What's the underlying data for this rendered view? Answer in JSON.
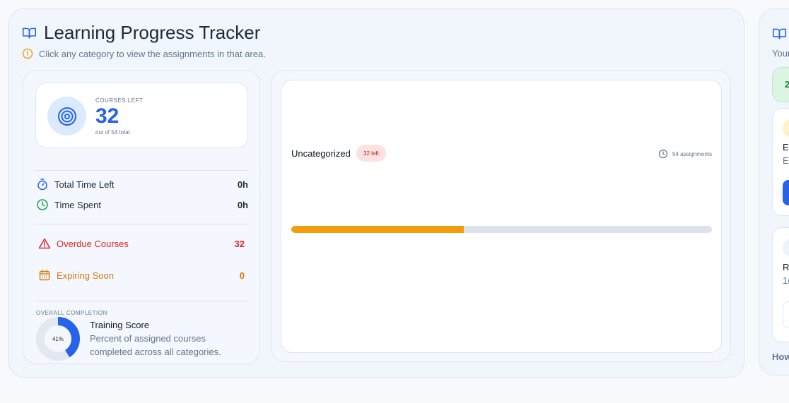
{
  "header": {
    "title": "Learning Progress Tracker",
    "hint": "Click any category to view the assignments in that area."
  },
  "summary": {
    "courses_left_label": "COURSES LEFT",
    "courses_left_value": "32",
    "courses_left_sub": "out of 54 total",
    "total_time_left_label": "Total Time Left",
    "total_time_left_value": "0h",
    "time_spent_label": "Time Spent",
    "time_spent_value": "0h",
    "overdue_label": "Overdue Courses",
    "overdue_value": "32",
    "expiring_label": "Expiring Soon",
    "expiring_value": "0",
    "overall_label": "OVERALL COMPLETION",
    "completion_text": "41%",
    "completion_fraction": 0.41,
    "training_score_title": "Training Score",
    "training_score_desc": "Percent of assigned courses completed across all categories."
  },
  "category": {
    "name": "Uncategorized",
    "badge": "32 left",
    "meta": "54 assignments",
    "progress_fraction": 0.41
  },
  "side_panel": {
    "hint_fragment": "Your",
    "green_badge_fragment": "2",
    "card1_fragment_a": "E",
    "card1_fragment_b": "E",
    "card2_fragment_a": "R",
    "card2_fragment_b": "1(",
    "footer_fragment": "How"
  },
  "colors": {
    "accent": "#2563eb",
    "danger": "#dc2626",
    "warning": "#d97706",
    "success": "#16a34a",
    "progress": "#f29e0c"
  },
  "icons": {
    "header": "book-open-icon",
    "hint": "info-circle-icon",
    "courses": "target-icon",
    "time_left": "stopwatch-icon",
    "time_spent": "clock-icon",
    "overdue": "warning-triangle-icon",
    "expiring": "calendar-icon",
    "category_meta": "clock-icon"
  }
}
